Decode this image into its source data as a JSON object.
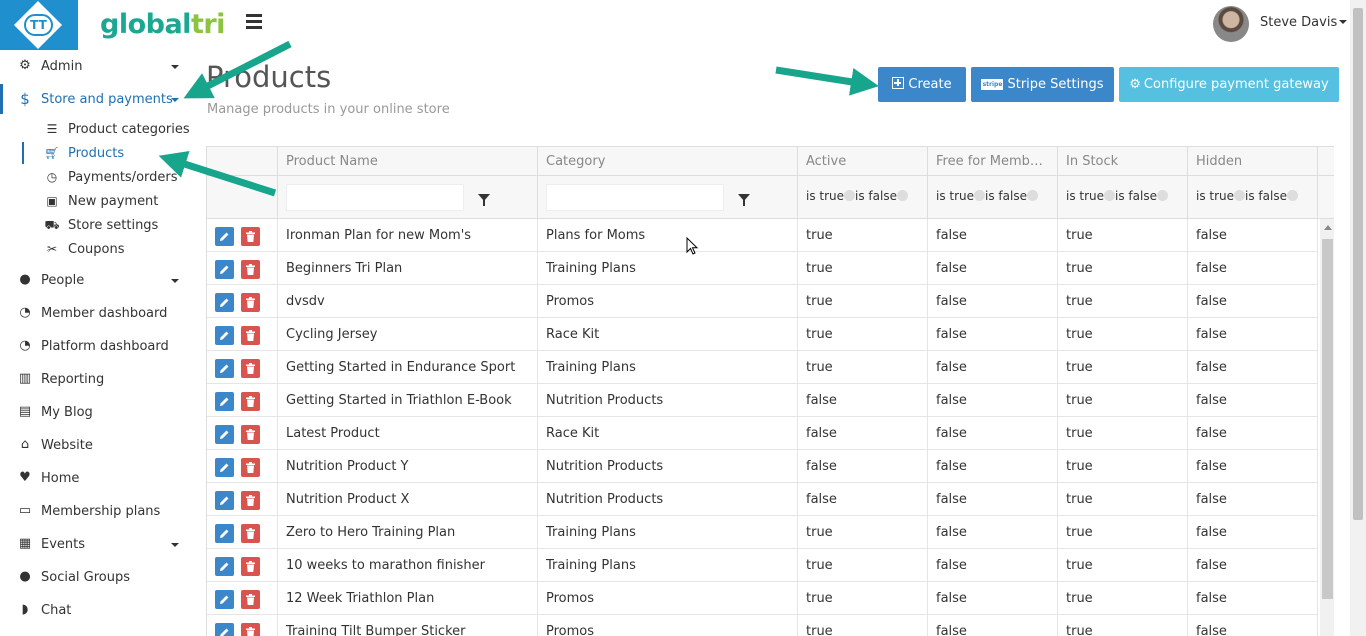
{
  "header": {
    "logo_text": "TT",
    "brand_part1": "global",
    "brand_part2": "tri",
    "user_name": "Steve Davis"
  },
  "sidebar": {
    "items": [
      {
        "label": "Admin",
        "icon": "gears-icon",
        "caret": true
      },
      {
        "label": "Store and payments",
        "icon": "dollar-icon",
        "caret": true,
        "active": true
      },
      {
        "label": "People",
        "icon": "person-icon",
        "caret": true
      },
      {
        "label": "Member dashboard",
        "icon": "dashboard-icon"
      },
      {
        "label": "Platform dashboard",
        "icon": "dashboard-icon"
      },
      {
        "label": "Reporting",
        "icon": "bar-chart-icon"
      },
      {
        "label": "My Blog",
        "icon": "newspaper-icon"
      },
      {
        "label": "Website",
        "icon": "home-icon"
      },
      {
        "label": "Home",
        "icon": "heartbeat-icon"
      },
      {
        "label": "Membership plans",
        "icon": "id-card-icon"
      },
      {
        "label": "Events",
        "icon": "calendar-icon",
        "caret": true
      },
      {
        "label": "Social Groups",
        "icon": "users-icon"
      },
      {
        "label": "Chat",
        "icon": "comments-icon"
      }
    ],
    "sub_items": [
      {
        "label": "Product categories",
        "icon": "list-icon"
      },
      {
        "label": "Products",
        "icon": "cart-icon",
        "active": true
      },
      {
        "label": "Payments/orders",
        "icon": "clock-icon"
      },
      {
        "label": "New payment",
        "icon": "money-icon"
      },
      {
        "label": "Store settings",
        "icon": "truck-icon"
      },
      {
        "label": "Coupons",
        "icon": "scissors-icon"
      }
    ]
  },
  "page": {
    "title": "Products",
    "subtitle": "Manage products in your online store"
  },
  "buttons": {
    "create": "Create",
    "stripe": "Stripe Settings",
    "stripe_badge": "stripe",
    "gateway": "Configure payment gateway"
  },
  "grid": {
    "columns": [
      "Product Name",
      "Category",
      "Active",
      "Free for Member...",
      "In Stock",
      "Hidden"
    ],
    "bool_filter": {
      "true_label": "is true",
      "false_label": "is false"
    },
    "rows": [
      [
        "Ironman Plan for new Mom's",
        "Plans for Moms",
        "true",
        "false",
        "true",
        "false"
      ],
      [
        "Beginners Tri Plan",
        "Training Plans",
        "true",
        "false",
        "true",
        "false"
      ],
      [
        "dvsdv",
        "Promos",
        "true",
        "false",
        "true",
        "false"
      ],
      [
        "Cycling Jersey",
        "Race Kit",
        "true",
        "false",
        "true",
        "false"
      ],
      [
        "Getting Started in Endurance Sport",
        "Training Plans",
        "true",
        "false",
        "true",
        "false"
      ],
      [
        "Getting Started in Triathlon E-Book",
        "Nutrition Products",
        "false",
        "false",
        "true",
        "false"
      ],
      [
        "Latest Product",
        "Race Kit",
        "false",
        "false",
        "true",
        "false"
      ],
      [
        "Nutrition Product Y",
        "Nutrition Products",
        "false",
        "false",
        "true",
        "false"
      ],
      [
        "Nutrition Product X",
        "Nutrition Products",
        "false",
        "false",
        "true",
        "false"
      ],
      [
        "Zero to Hero Training Plan",
        "Training Plans",
        "true",
        "false",
        "true",
        "false"
      ],
      [
        "10 weeks to marathon finisher",
        "Training Plans",
        "true",
        "false",
        "true",
        "false"
      ],
      [
        "12 Week Triathlon Plan",
        "Promos",
        "true",
        "false",
        "true",
        "false"
      ],
      [
        "Training Tilt Bumper Sticker",
        "Promos",
        "true",
        "false",
        "true",
        "false"
      ]
    ]
  },
  "colors": {
    "primary": "#3c87c9",
    "info": "#56c0e0",
    "danger": "#d9534f",
    "annotation_arrow": "#17a58c",
    "logo_bg": "#1f8fcd"
  }
}
